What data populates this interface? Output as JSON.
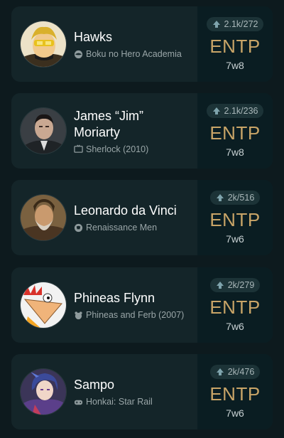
{
  "profiles": [
    {
      "name": "Hawks",
      "source": "Boku no Hero Academia",
      "source_icon": "anime-icon",
      "votes": "2.1k/272",
      "mbti": "ENTP",
      "enneagram": "7w8"
    },
    {
      "name": "James “Jim” Moriarty",
      "source": "Sherlock (2010)",
      "source_icon": "tv-icon",
      "votes": "2.1k/236",
      "mbti": "ENTP",
      "enneagram": "7w8"
    },
    {
      "name": "Leonardo da Vinci",
      "source": "Renaissance Men",
      "source_icon": "history-icon",
      "votes": "2k/516",
      "mbti": "ENTP",
      "enneagram": "7w6"
    },
    {
      "name": "Phineas Flynn",
      "source": "Phineas and Ferb (2007)",
      "source_icon": "cartoon-icon",
      "votes": "2k/279",
      "mbti": "ENTP",
      "enneagram": "7w6"
    },
    {
      "name": "Sampo",
      "source": "Honkai: Star Rail",
      "source_icon": "gamepad-icon",
      "votes": "2k/476",
      "mbti": "ENTP",
      "enneagram": "7w6"
    }
  ],
  "colors": {
    "background": "#0d1a1e",
    "card": "#142529",
    "side_panel": "#0a1d22",
    "mbti": "#c8a467"
  }
}
